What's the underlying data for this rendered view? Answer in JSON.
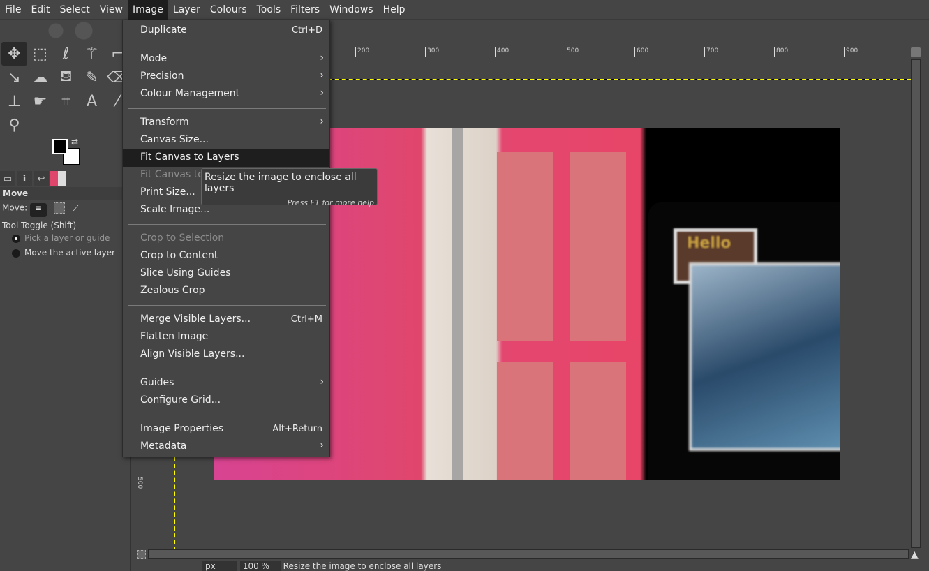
{
  "menubar": [
    "File",
    "Edit",
    "Select",
    "View",
    "Image",
    "Layer",
    "Colours",
    "Tools",
    "Filters",
    "Windows",
    "Help"
  ],
  "toolbox": {
    "tools": [
      {
        "icon": "move-icon",
        "g": "✥"
      },
      {
        "icon": "rect-select-icon",
        "g": "⬚"
      },
      {
        "icon": "lasso-icon",
        "g": "ℓ"
      },
      {
        "icon": "fuzzy-select-icon",
        "g": "⚚"
      },
      {
        "icon": "crop-icon",
        "g": "⌐"
      },
      {
        "icon": "transform-icon",
        "g": "↘"
      },
      {
        "icon": "warp-icon",
        "g": "☁"
      },
      {
        "icon": "bucket-fill-icon",
        "g": "⛾"
      },
      {
        "icon": "paintbrush-icon",
        "g": "✎"
      },
      {
        "icon": "eraser-icon",
        "g": "⌫"
      },
      {
        "icon": "clone-icon",
        "g": "⊥"
      },
      {
        "icon": "smudge-icon",
        "g": "☛"
      },
      {
        "icon": "paths-icon",
        "g": "⌗"
      },
      {
        "icon": "text-icon",
        "g": "A"
      },
      {
        "icon": "color-picker-icon",
        "g": "⁄"
      },
      {
        "icon": "zoom-icon",
        "g": "⚲"
      }
    ],
    "options_title": "Move",
    "move_label": "Move:",
    "tool_toggle": "Tool Toggle  (Shift)",
    "radio1": "Pick a layer or guide",
    "radio2": "Move the active layer"
  },
  "ruler": [
    "200",
    "300",
    "400",
    "500",
    "600",
    "700",
    "800",
    "900"
  ],
  "ruler_left": "500",
  "image_text": "Hello",
  "status": {
    "unit": "px",
    "zoom": "100 %",
    "message": "Resize the image to enclose all layers"
  },
  "menu": [
    {
      "label": "Duplicate",
      "shortcut": "Ctrl+D"
    },
    {
      "sep": true
    },
    {
      "label": "Mode",
      "sub": true
    },
    {
      "label": "Precision",
      "sub": true
    },
    {
      "label": "Colour Management",
      "sub": true
    },
    {
      "sep": true
    },
    {
      "label": "Transform",
      "sub": true
    },
    {
      "label": "Canvas Size..."
    },
    {
      "label": "Fit Canvas to Layers",
      "highlight": true
    },
    {
      "label": "Fit Canvas to Selection",
      "disabled": true
    },
    {
      "label": "Print Size..."
    },
    {
      "label": "Scale Image..."
    },
    {
      "sep": true
    },
    {
      "label": "Crop to Selection",
      "disabled": true
    },
    {
      "label": "Crop to Content"
    },
    {
      "label": "Slice Using Guides"
    },
    {
      "label": "Zealous Crop"
    },
    {
      "sep": true
    },
    {
      "label": "Merge Visible Layers...",
      "shortcut": "Ctrl+M"
    },
    {
      "label": "Flatten Image"
    },
    {
      "label": "Align Visible Layers..."
    },
    {
      "sep": true
    },
    {
      "label": "Guides",
      "sub": true
    },
    {
      "label": "Configure Grid..."
    },
    {
      "sep": true
    },
    {
      "label": "Image Properties",
      "shortcut": "Alt+Return"
    },
    {
      "label": "Metadata",
      "sub": true
    }
  ],
  "tooltip": {
    "text": "Resize the image to enclose all layers",
    "help": "Press F1 for more help"
  }
}
